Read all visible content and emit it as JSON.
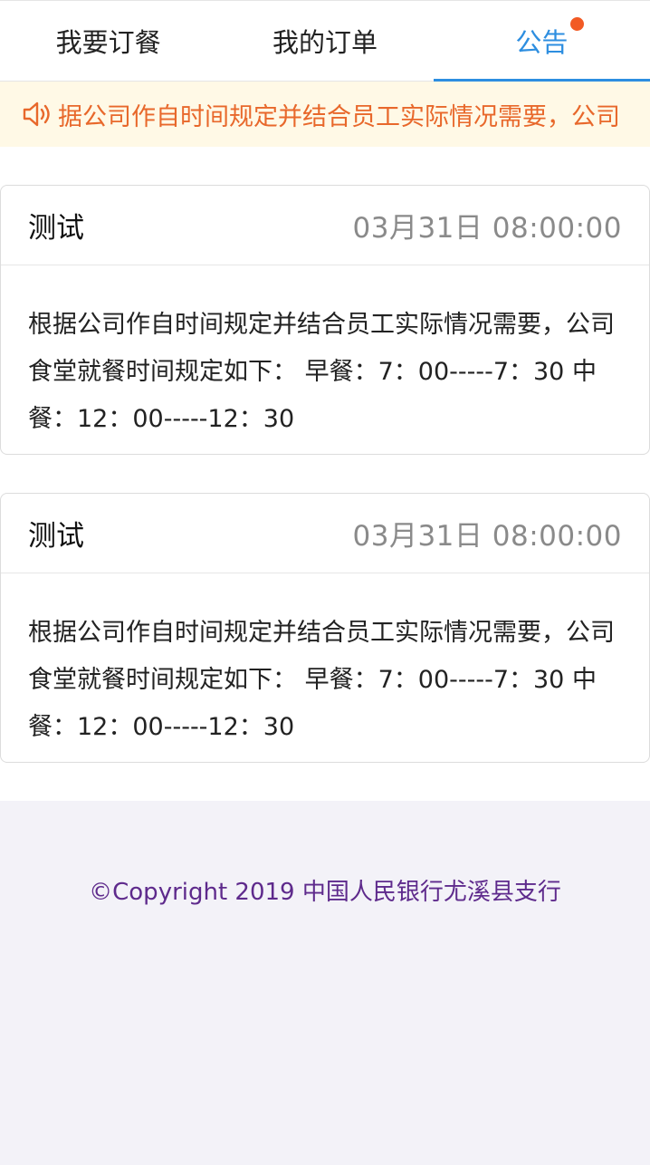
{
  "tabs": [
    {
      "label": "我要订餐",
      "active": false
    },
    {
      "label": "我的订单",
      "active": false
    },
    {
      "label": "公告",
      "active": true,
      "has_dot": true
    }
  ],
  "notice_bar": {
    "icon": "speaker-icon",
    "text": "据公司作自时间规定并结合员工实际情况需要，公司"
  },
  "announcements": [
    {
      "title": "测试",
      "time": "03月31日 08:00:00",
      "body": "根据公司作自时间规定并结合员工实际情况需要，公司食堂就餐时间规定如下： 早餐：7：00-----7：30 中餐：12：00-----12：30"
    },
    {
      "title": "测试",
      "time": "03月31日 08:00:00",
      "body": "根据公司作自时间规定并结合员工实际情况需要，公司食堂就餐时间规定如下： 早餐：7：00-----7：30 中餐：12：00-----12：30"
    }
  ],
  "footer": {
    "copyright": "©Copyright 2019 中国人民银行尤溪县支行"
  },
  "colors": {
    "accent": "#2d8ee0",
    "notice_bg": "#fff9e6",
    "notice_text": "#e8682b",
    "dot": "#f25a24",
    "footer_bg": "#f3f2f8",
    "copyright": "#5e2a8c"
  }
}
